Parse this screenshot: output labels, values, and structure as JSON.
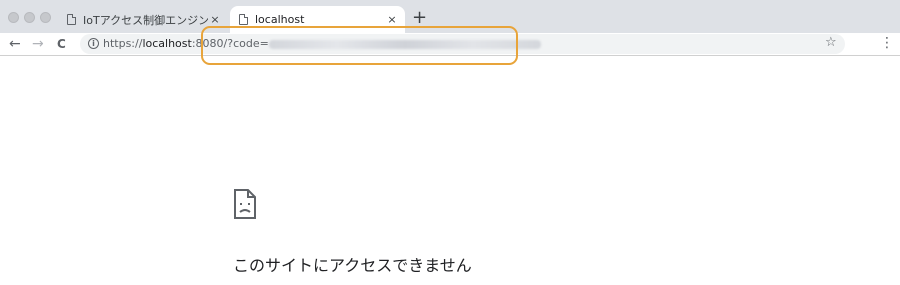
{
  "tabs": [
    {
      "title": "IoTアクセス制御エンジン 開発者向",
      "close": "×"
    },
    {
      "title": "localhost",
      "close": "×"
    }
  ],
  "new_tab_label": "+",
  "nav": {
    "back": "←",
    "forward": "→",
    "reload": "C"
  },
  "omnibox": {
    "info": "i",
    "url_scheme": "https://",
    "url_host": "localhost",
    "url_rest": ":8080/?code="
  },
  "toolbar": {
    "star": "☆",
    "menu": "⋮"
  },
  "error": {
    "title": "このサイトにアクセスできません"
  },
  "colors": {
    "highlight": "#e8a43a",
    "tabbar": "#dee1e6",
    "omnibox": "#f1f3f4"
  }
}
